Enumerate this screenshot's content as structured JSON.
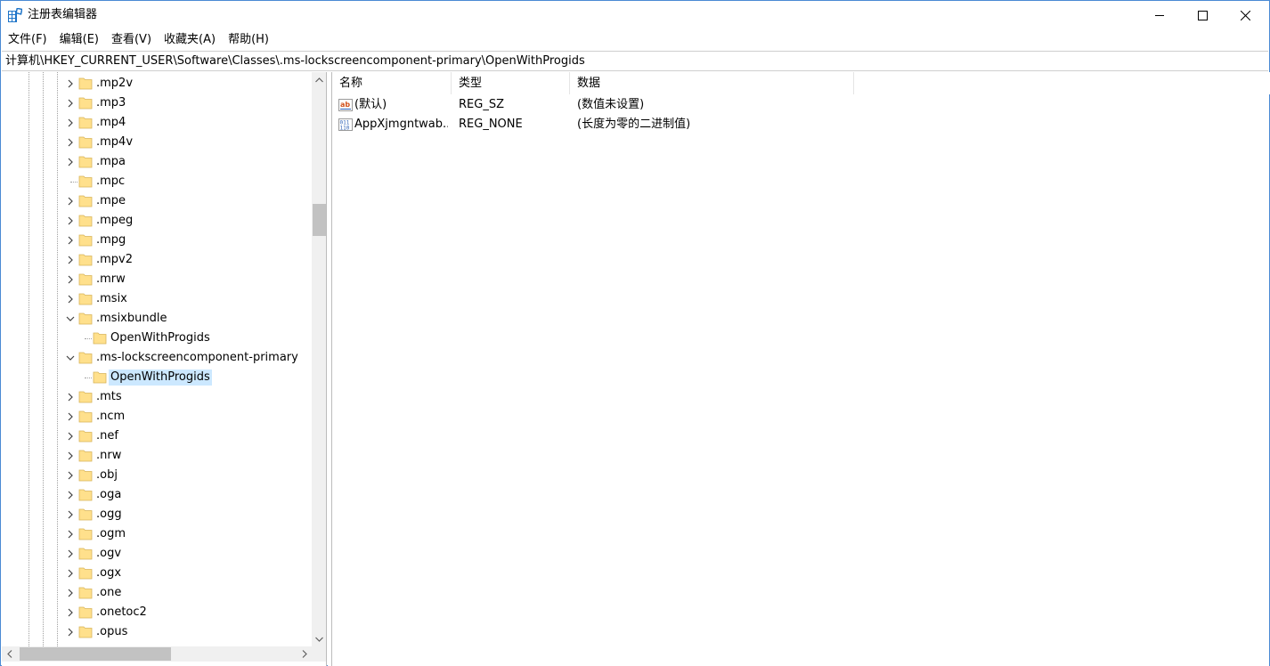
{
  "window": {
    "title": "注册表编辑器",
    "controls": {
      "minimize": "minimize",
      "maximize": "maximize",
      "close": "close"
    }
  },
  "menu": [
    "文件(F)",
    "编辑(E)",
    "查看(V)",
    "收藏夹(A)",
    "帮助(H)"
  ],
  "address": "计算机\\HKEY_CURRENT_USER\\Software\\Classes\\.ms-lockscreencomponent-primary\\OpenWithProgids",
  "tree": [
    {
      "label": ".mp2v",
      "expander": "collapsed",
      "depth": 0
    },
    {
      "label": ".mp3",
      "expander": "collapsed",
      "depth": 0
    },
    {
      "label": ".mp4",
      "expander": "collapsed",
      "depth": 0
    },
    {
      "label": ".mp4v",
      "expander": "collapsed",
      "depth": 0
    },
    {
      "label": ".mpa",
      "expander": "collapsed",
      "depth": 0
    },
    {
      "label": ".mpc",
      "expander": "none",
      "depth": 0
    },
    {
      "label": ".mpe",
      "expander": "collapsed",
      "depth": 0
    },
    {
      "label": ".mpeg",
      "expander": "collapsed",
      "depth": 0
    },
    {
      "label": ".mpg",
      "expander": "collapsed",
      "depth": 0
    },
    {
      "label": ".mpv2",
      "expander": "collapsed",
      "depth": 0
    },
    {
      "label": ".mrw",
      "expander": "collapsed",
      "depth": 0
    },
    {
      "label": ".msix",
      "expander": "collapsed",
      "depth": 0
    },
    {
      "label": ".msixbundle",
      "expander": "expanded",
      "depth": 0
    },
    {
      "label": "OpenWithProgids",
      "expander": "none",
      "depth": 1
    },
    {
      "label": ".ms-lockscreencomponent-primary",
      "expander": "expanded",
      "depth": 0
    },
    {
      "label": "OpenWithProgids",
      "expander": "none",
      "depth": 1,
      "selected": true
    },
    {
      "label": ".mts",
      "expander": "collapsed",
      "depth": 0
    },
    {
      "label": ".ncm",
      "expander": "collapsed",
      "depth": 0
    },
    {
      "label": ".nef",
      "expander": "collapsed",
      "depth": 0
    },
    {
      "label": ".nrw",
      "expander": "collapsed",
      "depth": 0
    },
    {
      "label": ".obj",
      "expander": "collapsed",
      "depth": 0
    },
    {
      "label": ".oga",
      "expander": "collapsed",
      "depth": 0
    },
    {
      "label": ".ogg",
      "expander": "collapsed",
      "depth": 0
    },
    {
      "label": ".ogm",
      "expander": "collapsed",
      "depth": 0
    },
    {
      "label": ".ogv",
      "expander": "collapsed",
      "depth": 0
    },
    {
      "label": ".ogx",
      "expander": "collapsed",
      "depth": 0
    },
    {
      "label": ".one",
      "expander": "collapsed",
      "depth": 0
    },
    {
      "label": ".onetoc2",
      "expander": "collapsed",
      "depth": 0
    },
    {
      "label": ".opus",
      "expander": "collapsed",
      "depth": 0
    }
  ],
  "list": {
    "columns": [
      "名称",
      "类型",
      "数据"
    ],
    "rows": [
      {
        "name": "(默认)",
        "type": "REG_SZ",
        "data": "(数值未设置)",
        "icon": "string-value-icon"
      },
      {
        "name": "AppXjmgntwab...",
        "type": "REG_NONE",
        "data": "(长度为零的二进制值)",
        "icon": "binary-value-icon"
      }
    ]
  },
  "colors": {
    "accent": "#4a8ad4",
    "selection": "#cce8ff",
    "folder": "#ffe08c",
    "string_icon": "#d2521c",
    "binary_icon": "#2b5fb4"
  }
}
